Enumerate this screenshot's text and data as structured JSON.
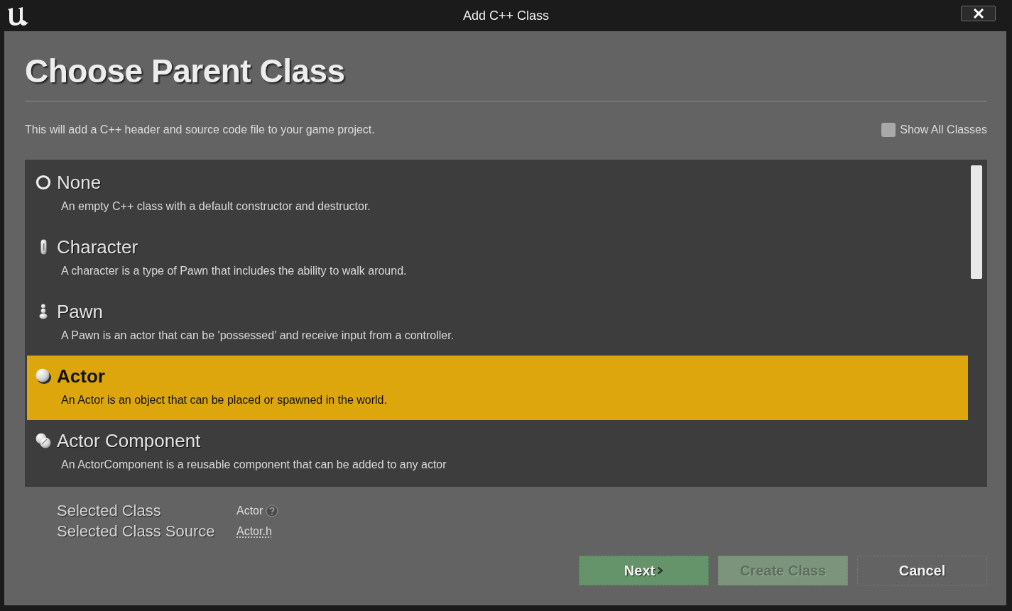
{
  "window": {
    "title": "Add C++ Class"
  },
  "heading": "Choose Parent Class",
  "description": "This will add a C++ header and source code file to your game project.",
  "show_all_classes": {
    "label": "Show All Classes",
    "checked": false
  },
  "classes": [
    {
      "kind": "none",
      "name": "None",
      "description": "An empty C++ class with a default constructor and destructor.",
      "selected": false
    },
    {
      "kind": "character",
      "name": "Character",
      "description": "A character is a type of Pawn that includes the ability to walk around.",
      "selected": false
    },
    {
      "kind": "pawn",
      "name": "Pawn",
      "description": "A Pawn is an actor that can be 'possessed' and receive input from a controller.",
      "selected": false
    },
    {
      "kind": "actor",
      "name": "Actor",
      "description": "An Actor is an object that can be placed or spawned in the world.",
      "selected": true
    },
    {
      "kind": "actor_component",
      "name": "Actor Component",
      "description": "An ActorComponent is a reusable component that can be added to any actor",
      "selected": false
    }
  ],
  "selected_class": {
    "label": "Selected Class",
    "value": "Actor"
  },
  "selected_class_source": {
    "label": "Selected Class Source",
    "value": "Actor.h"
  },
  "buttons": [
    {
      "kind": "next",
      "label": "Next",
      "disabled": false
    },
    {
      "kind": "create",
      "label": "Create Class",
      "disabled": true
    },
    {
      "kind": "cancel",
      "label": "Cancel",
      "disabled": false
    }
  ]
}
